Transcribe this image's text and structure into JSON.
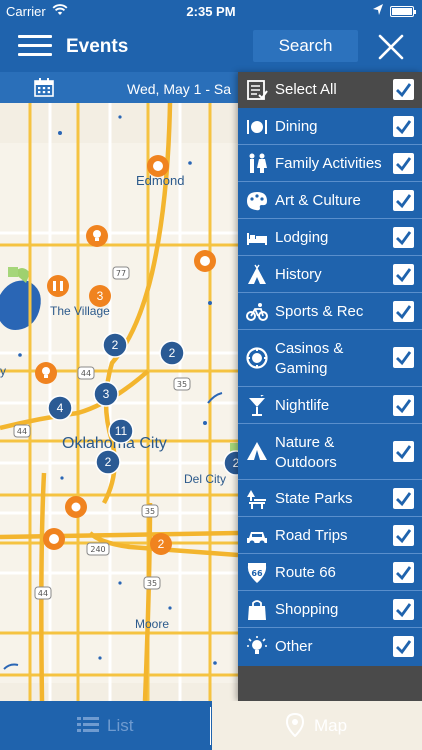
{
  "status_bar": {
    "carrier": "Carrier",
    "time": "2:35 PM"
  },
  "header": {
    "title": "Events",
    "search_label": "Search"
  },
  "date_bar": {
    "date_text": "Wed, May 1  -  Sa"
  },
  "map": {
    "place_labels": {
      "edmond": "Edmond",
      "the_village": "The Village",
      "oklahoma_city": "Oklahoma City",
      "del_city": "Del City",
      "moore": "Moore",
      "left_edge_y": "y"
    },
    "highway_shields": [
      "77",
      "44",
      "35",
      "44",
      "35",
      "240",
      "35",
      "44"
    ],
    "clusters": [
      {
        "count": "3"
      },
      {
        "count": "2"
      },
      {
        "count": "2"
      },
      {
        "count": "3"
      },
      {
        "count": "4"
      },
      {
        "count": "11"
      },
      {
        "count": "2"
      },
      {
        "count": "2"
      },
      {
        "count": "2"
      }
    ]
  },
  "filters": {
    "items": [
      {
        "label": "Select All",
        "icon": "checklist-icon",
        "checked": true
      },
      {
        "label": "Dining",
        "icon": "dining-icon",
        "checked": true
      },
      {
        "label": "Family Activities",
        "icon": "family-icon",
        "checked": true
      },
      {
        "label": "Art & Culture",
        "icon": "palette-icon",
        "checked": true
      },
      {
        "label": "Lodging",
        "icon": "bed-icon",
        "checked": true
      },
      {
        "label": "History",
        "icon": "teepee-icon",
        "checked": true
      },
      {
        "label": "Sports & Rec",
        "icon": "bike-icon",
        "checked": true
      },
      {
        "label": "Casinos & Gaming",
        "icon": "casino-chip-icon",
        "checked": true
      },
      {
        "label": "Nightlife",
        "icon": "cocktail-icon",
        "checked": true
      },
      {
        "label": "Nature & Outdoors",
        "icon": "tent-icon",
        "checked": true
      },
      {
        "label": "State Parks",
        "icon": "park-icon",
        "checked": true
      },
      {
        "label": "Road Trips",
        "icon": "car-icon",
        "checked": true
      },
      {
        "label": "Route 66",
        "icon": "route66-icon",
        "checked": true
      },
      {
        "label": "Shopping",
        "icon": "shopping-bag-icon",
        "checked": true
      },
      {
        "label": "Other",
        "icon": "lightbulb-icon",
        "checked": true
      }
    ]
  },
  "tabs": {
    "list_label": "List",
    "map_label": "Map"
  },
  "colors": {
    "primary_blue": "#1f63ad",
    "cluster_blue": "#2a5a94",
    "marker_orange": "#f0831f",
    "road_yellow": "#f5c341",
    "panel_dark": "#4a4a4a"
  }
}
